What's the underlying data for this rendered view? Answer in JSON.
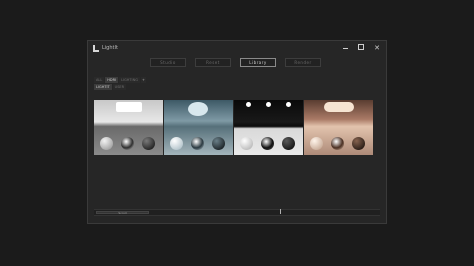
{
  "window": {
    "title": "LightIt",
    "controls": [
      "minimize-icon",
      "maximize-icon",
      "close-icon"
    ]
  },
  "main_tabs": [
    {
      "label": "Studio",
      "active": false
    },
    {
      "label": "Reset",
      "active": false
    },
    {
      "label": "Library",
      "active": true
    },
    {
      "label": "Render",
      "active": false
    }
  ],
  "filter_tabs": [
    "ALL",
    "HDRI",
    "LIGHTING",
    "+"
  ],
  "filter_tabs_row2": [
    "LIGHTIT",
    "USER"
  ],
  "scrollbar": {
    "thumb_label": "Scroll"
  },
  "colors": {
    "background": "#1b1b1b",
    "window": "#262626",
    "active_tab_border": "#8a8a8a"
  }
}
